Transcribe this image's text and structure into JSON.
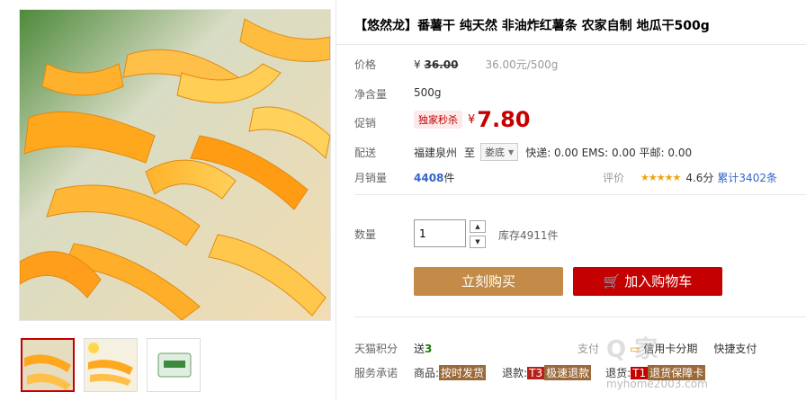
{
  "product": {
    "title": "【悠然龙】番薯干 纯天然 非油炸红薯条 农家自制 地瓜干500g"
  },
  "price_row": {
    "label": "价格",
    "currency": "¥",
    "original": "36.00",
    "unit_price": "36.00元/500g"
  },
  "net_row": {
    "label": "净含量",
    "value": "500g"
  },
  "promo_row": {
    "label": "促销",
    "tag": "独家秒杀",
    "currency": "¥",
    "price": "7.80"
  },
  "ship_row": {
    "label": "配送",
    "from": "福建泉州",
    "to_label": "至",
    "to": "娄底",
    "fees": "快递: 0.00 EMS: 0.00 平邮: 0.00"
  },
  "sales_row": {
    "label": "月销量",
    "count": "4408",
    "unit": "件",
    "rating_label": "评价",
    "stars": "★★★★★",
    "score": "4.6分",
    "reviews": "累计3402条"
  },
  "quantity": {
    "label": "数量",
    "value": "1",
    "stock": "库存4911件"
  },
  "buttons": {
    "buy": "立刻购买",
    "cart": "加入购物车"
  },
  "points_row": {
    "label": "天猫积分",
    "send": "送",
    "points": "3",
    "pay_label": "支付",
    "credit": "信用卡分期",
    "quick": "快捷支付"
  },
  "service_row": {
    "label": "服务承诺",
    "goods_label": "商品:",
    "goods_badge": "按时发货",
    "refund_label": "退款:",
    "refund_code": "T3",
    "refund_badge": "极速退款",
    "return_label": "退货:",
    "return_code": "T1",
    "return_badge": "退货保障卡"
  },
  "watermark": {
    "text": "Q 家",
    "url": "myhome2003.com"
  },
  "colors": {
    "accent": "#c40000",
    "buy": "#c48b48",
    "link": "#3366cc"
  },
  "icons": [
    "cart-icon",
    "credit-card-icon",
    "chevron-down-icon",
    "spin-up-icon",
    "spin-down-icon",
    "star-icon"
  ]
}
